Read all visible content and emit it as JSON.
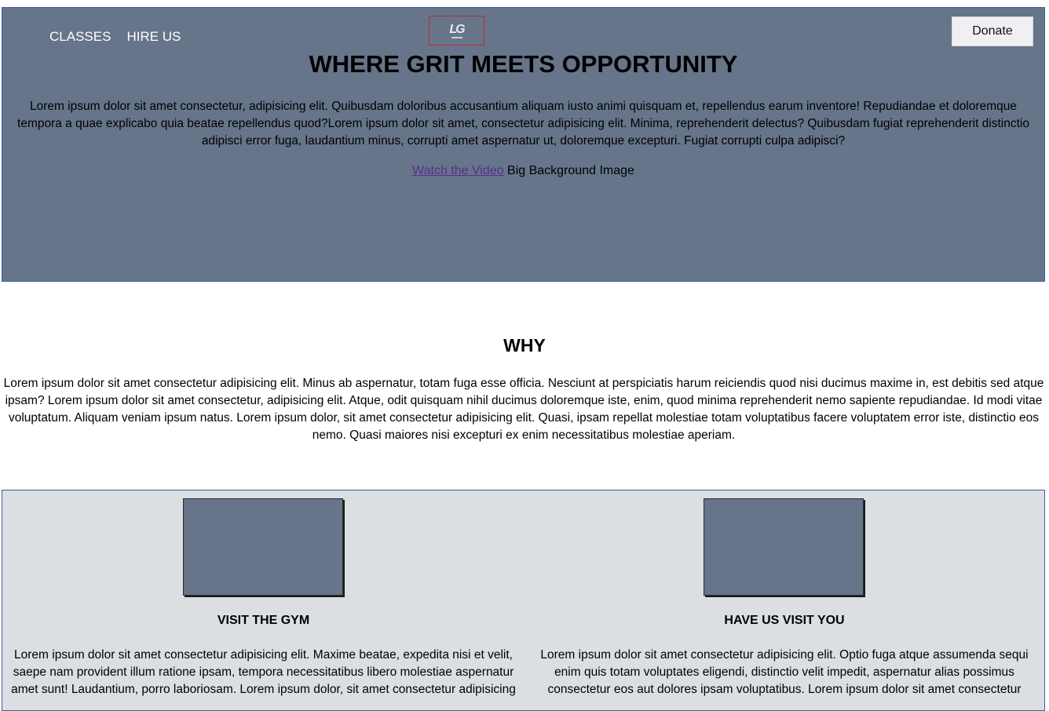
{
  "nav": {
    "items": [
      "CLASSES",
      "HIRE US"
    ]
  },
  "logo": {
    "mark": "LG"
  },
  "donate_label": "Donate",
  "hero": {
    "title": "WHERE GRIT MEETS OPPORTUNITY",
    "lead": "Lorem ipsum dolor sit amet consectetur, adipisicing elit. Quibusdam doloribus accusantium aliquam iusto animi quisquam et, repellendus earum inventore! Repudiandae et doloremque tempora a quae explicabo quia beatae repellendus quod?Lorem ipsum dolor sit amet, consectetur adipisicing elit. Minima, reprehenderit delectus? Quibusdam fugiat reprehenderit distinctio adipisci error fuga, laudantium minus, corrupti amet aspernatur ut, doloremque excepturi. Fugiat corrupti culpa adipisci?",
    "video_link": "Watch the Video",
    "video_suffix": " Big Background Image"
  },
  "why": {
    "title": "WHY",
    "text": "Lorem ipsum dolor sit amet consectetur adipisicing elit. Minus ab aspernatur, totam fuga esse officia. Nesciunt at perspiciatis harum reiciendis quod nisi ducimus maxime in, est debitis sed atque ipsam? Lorem ipsum dolor sit amet consectetur, adipisicing elit. Atque, odit quisquam nihil ducimus doloremque iste, enim, quod minima reprehenderit nemo sapiente repudiandae. Id modi vitae voluptatum. Aliquam veniam ipsum natus. Lorem ipsum dolor, sit amet consectetur adipisicing elit. Quasi, ipsam repellat molestiae totam voluptatibus facere voluptatem error iste, distinctio eos nemo. Quasi maiores nisi excepturi ex enim necessitatibus molestiae aperiam."
  },
  "cards": [
    {
      "title": "VISIT THE GYM",
      "text": "Lorem ipsum dolor sit amet consectetur adipisicing elit. Maxime beatae, expedita nisi et velit, saepe nam provident illum ratione ipsam, tempora necessitatibus libero molestiae aspernatur amet sunt! Laudantium, porro laboriosam. Lorem ipsum dolor, sit amet consectetur adipisicing"
    },
    {
      "title": "HAVE US VISIT YOU",
      "text": "Lorem ipsum dolor sit amet consectetur adipisicing elit. Optio fuga atque assumenda sequi enim quis totam voluptates eligendi, distinctio velit impedit, aspernatur alias possimus consectetur eos aut dolores ipsam voluptatibus. Lorem ipsum dolor sit amet consectetur"
    }
  ],
  "colors": {
    "hero_bg": "#66758a",
    "section_bg": "#dcdfe2",
    "link": "#5a2d8c",
    "border": "#3f5f9a"
  }
}
